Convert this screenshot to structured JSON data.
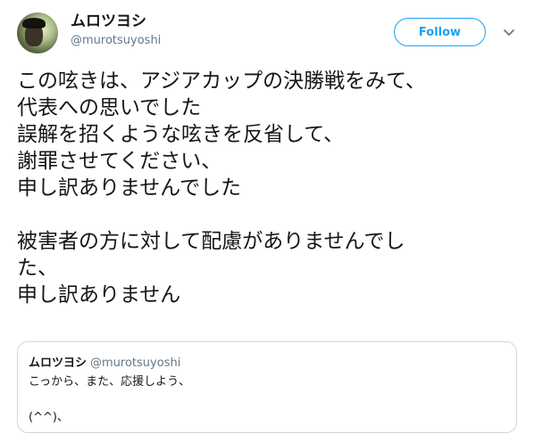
{
  "author": {
    "name": "ムロツヨシ",
    "handle": "@murotsuyoshi"
  },
  "follow_button": {
    "label": "Follow"
  },
  "icons": {
    "avatar": "user-avatar",
    "menu": "chevron-down-icon"
  },
  "colors": {
    "accent": "#1da1f2",
    "secondary_text": "#657786",
    "border": "#ccd6dd",
    "text": "#14171a"
  },
  "tweet": {
    "lines": [
      "この呟きは、アジアカップの決勝戦をみて、",
      "代表への思いでした",
      "誤解を招くような呟きを反省して、",
      "謝罪させてください、",
      "申し訳ありませんでした",
      "",
      "被害者の方に対して配慮がありませんでし",
      "た、",
      "申し訳ありません"
    ]
  },
  "quoted_tweet": {
    "name": "ムロツヨシ",
    "handle": "@murotsuyoshi",
    "lines": [
      "こっから、また、応援しよう、",
      "",
      "(^^)、"
    ]
  }
}
